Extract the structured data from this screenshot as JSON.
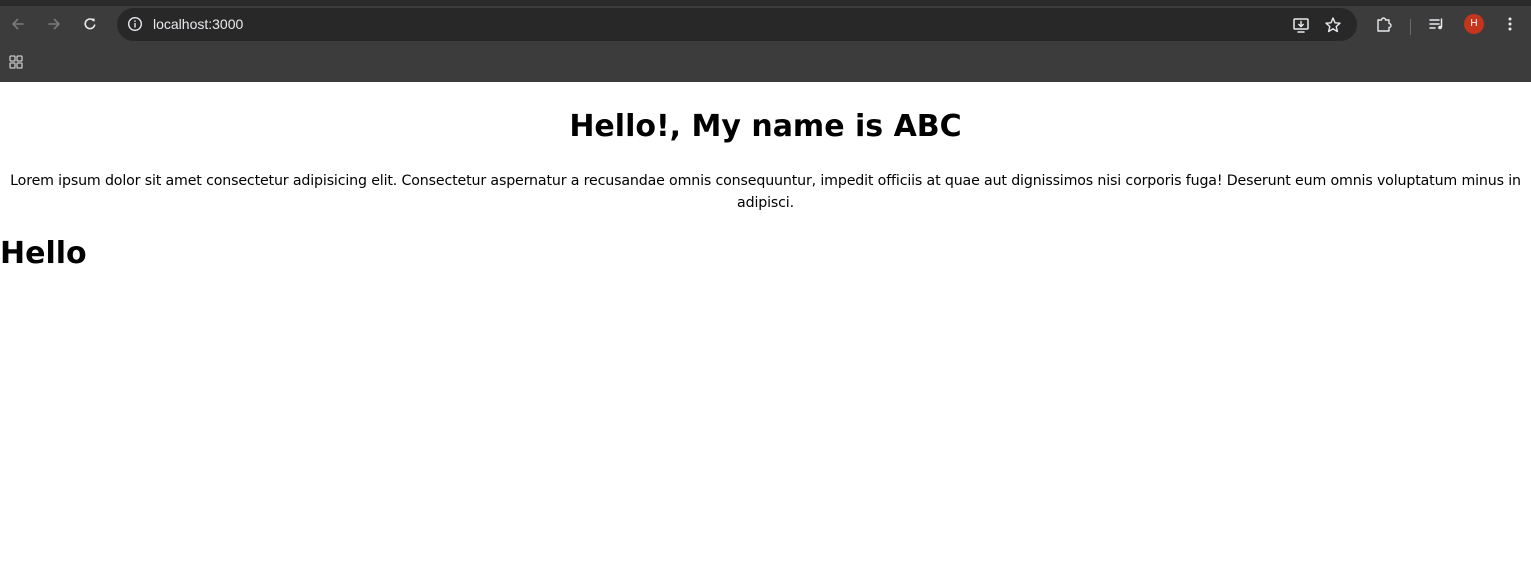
{
  "browser": {
    "url": "localhost:3000",
    "profile_initial": "H",
    "profile_color": "#c5341d",
    "icons": {
      "back": "back-arrow-icon",
      "forward": "forward-arrow-icon",
      "reload": "reload-icon",
      "site_info": "info-icon",
      "install": "install-app-icon",
      "bookmark": "star-icon",
      "extensions": "puzzle-icon",
      "media": "media-controls-icon",
      "menu": "kebab-menu-icon",
      "apps": "apps-grid-icon"
    }
  },
  "page": {
    "heading": "Hello!, My name is ABC",
    "paragraph": "Lorem ipsum dolor sit amet consectetur adipisicing elit. Consectetur aspernatur a recusandae omnis consequuntur, impedit officiis at quae aut dignissimos nisi corporis fuga! Deserunt eum omnis voluptatum minus in adipisci.",
    "subheading": "Hello"
  }
}
